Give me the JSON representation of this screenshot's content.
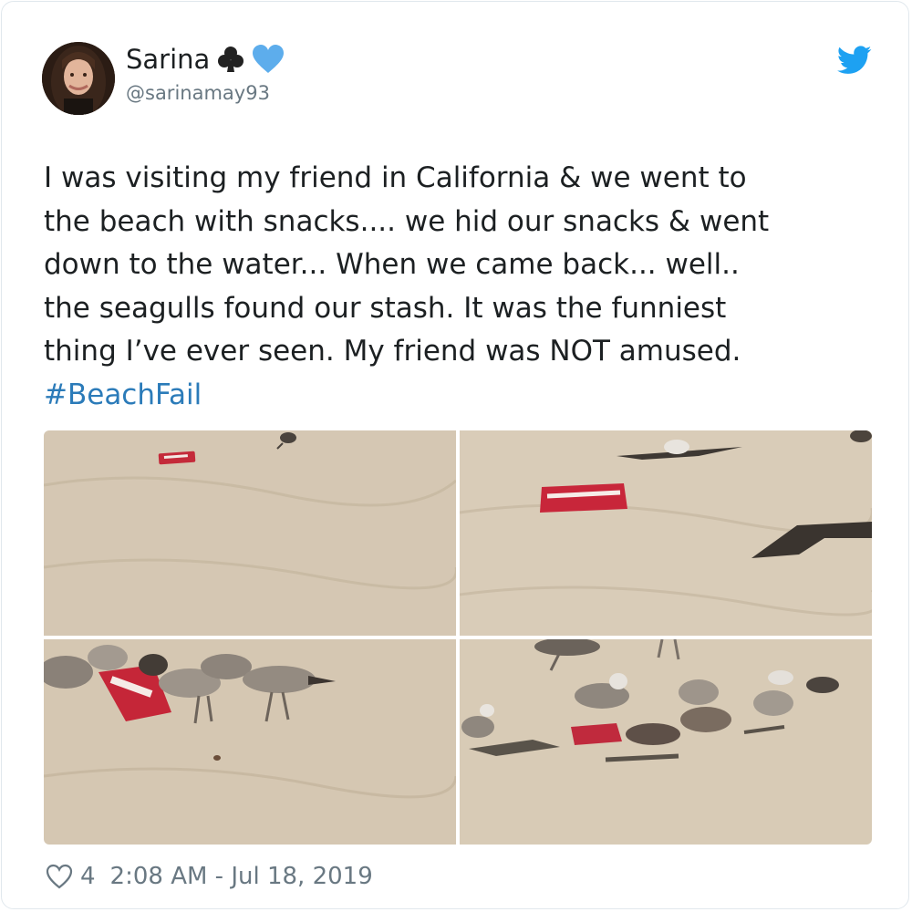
{
  "tweet": {
    "display_name": "Sarina",
    "handle": "@sarinamay93",
    "text": "I was visiting my friend in California & we went to\nthe beach with snacks.... we hid our snacks & went\ndown to the water... When we came back... well..\nthe seagulls found our stash. It was the funniest\nthing I’ve ever seen. My friend was NOT amused.",
    "hashtag": "#BeachFail",
    "like_count": "4",
    "timestamp": "2:08 AM - Jul 18, 2019"
  },
  "icons": {
    "name_emoji_1": "club-icon",
    "name_emoji_2": "blue-heart-icon",
    "brand": "twitter-bird-icon",
    "like": "heart-outline-icon"
  },
  "colors": {
    "link": "#2b7bb9",
    "twitter_blue": "#1da1f2",
    "heart_emoji": "#5dadec",
    "secondary_text": "#697882",
    "sand": "#d6c9b4"
  }
}
